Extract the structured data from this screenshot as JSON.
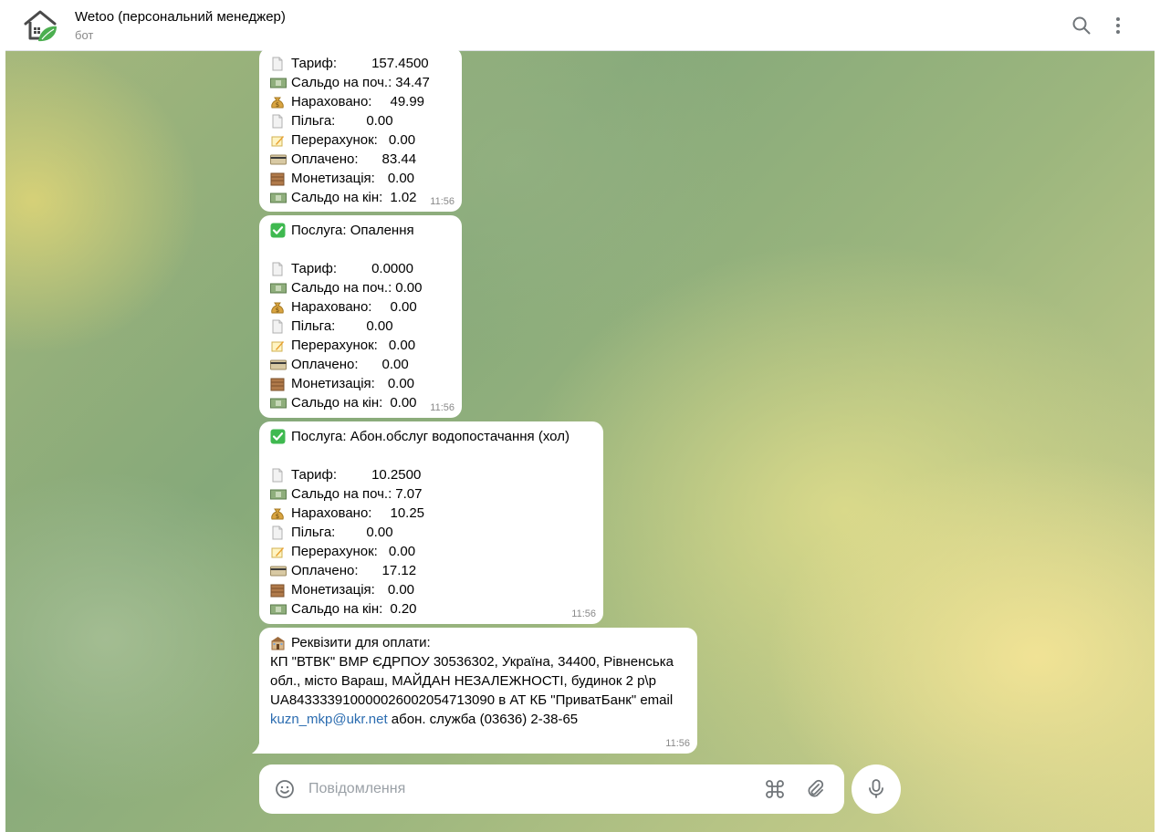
{
  "header": {
    "title": "Wetoo (персональний менеджер)",
    "subtitle": "бот"
  },
  "messages": {
    "m1": {
      "lines": [
        {
          "label": "Тариф:",
          "value": "157.4500"
        },
        {
          "label": "Сальдо на поч.:",
          "value": "34.47"
        },
        {
          "label": "Нараховано:",
          "value": "49.99"
        },
        {
          "label": "Пільга:",
          "value": "0.00"
        },
        {
          "label": "Перерахунок:",
          "value": "0.00"
        },
        {
          "label": "Оплачено:",
          "value": "83.44"
        },
        {
          "label": "Монетизація:",
          "value": "0.00"
        },
        {
          "label": "Сальдо на кін:",
          "value": "1.02"
        }
      ],
      "time": "11:56"
    },
    "m2": {
      "service_label": "Послуга:",
      "service_name": "Опалення",
      "lines": [
        {
          "label": "Тариф:",
          "value": "0.0000"
        },
        {
          "label": "Сальдо на поч.:",
          "value": "0.00"
        },
        {
          "label": "Нараховано:",
          "value": "0.00"
        },
        {
          "label": "Пільга:",
          "value": "0.00"
        },
        {
          "label": "Перерахунок:",
          "value": "0.00"
        },
        {
          "label": "Оплачено:",
          "value": "0.00"
        },
        {
          "label": "Монетизація:",
          "value": "0.00"
        },
        {
          "label": "Сальдо на кін:",
          "value": "0.00"
        }
      ],
      "time": "11:56"
    },
    "m3": {
      "service_label": "Послуга:",
      "service_name": "Абон.обслуг водопостачання (хол)",
      "lines": [
        {
          "label": "Тариф:",
          "value": "10.2500"
        },
        {
          "label": "Сальдо на поч.:",
          "value": "7.07"
        },
        {
          "label": "Нараховано:",
          "value": "10.25"
        },
        {
          "label": "Пільга:",
          "value": "0.00"
        },
        {
          "label": "Перерахунок:",
          "value": "0.00"
        },
        {
          "label": "Оплачено:",
          "value": "17.12"
        },
        {
          "label": "Монетизація:",
          "value": "0.00"
        },
        {
          "label": "Сальдо на кін:",
          "value": "0.20"
        }
      ],
      "time": "11:56"
    },
    "m4": {
      "heading": "Реквізити для оплати:",
      "text_before_link": "КП \"ВТВК\" ВМР ЄДРПОУ 30536302, Україна, 34400, Рівненська обл., місто Вараш, МАЙДАН НЕЗАЛЕЖНОСТІ, будинок 2 р\\р UA843333910000026002054713090 в АТ КБ \"ПриватБанк\" email ",
      "link": "kuzn_mkp@ukr.net",
      "text_after_link": " абон. служба (03636) 2-38-65",
      "time": "11:56"
    }
  },
  "composer": {
    "placeholder": "Повідомлення"
  },
  "icons": {
    "line_icons": [
      "page-facing-up-icon",
      "money-banknote-icon",
      "money-bag-icon",
      "page-facing-up-icon",
      "memo-icon",
      "credit-card-icon",
      "wooden-box-icon",
      "money-banknote-icon"
    ],
    "check": "check-mark-button-icon",
    "bank": "bank-icon"
  },
  "colors": {
    "link": "#2b6cb0",
    "check_green": "#3fb950"
  }
}
